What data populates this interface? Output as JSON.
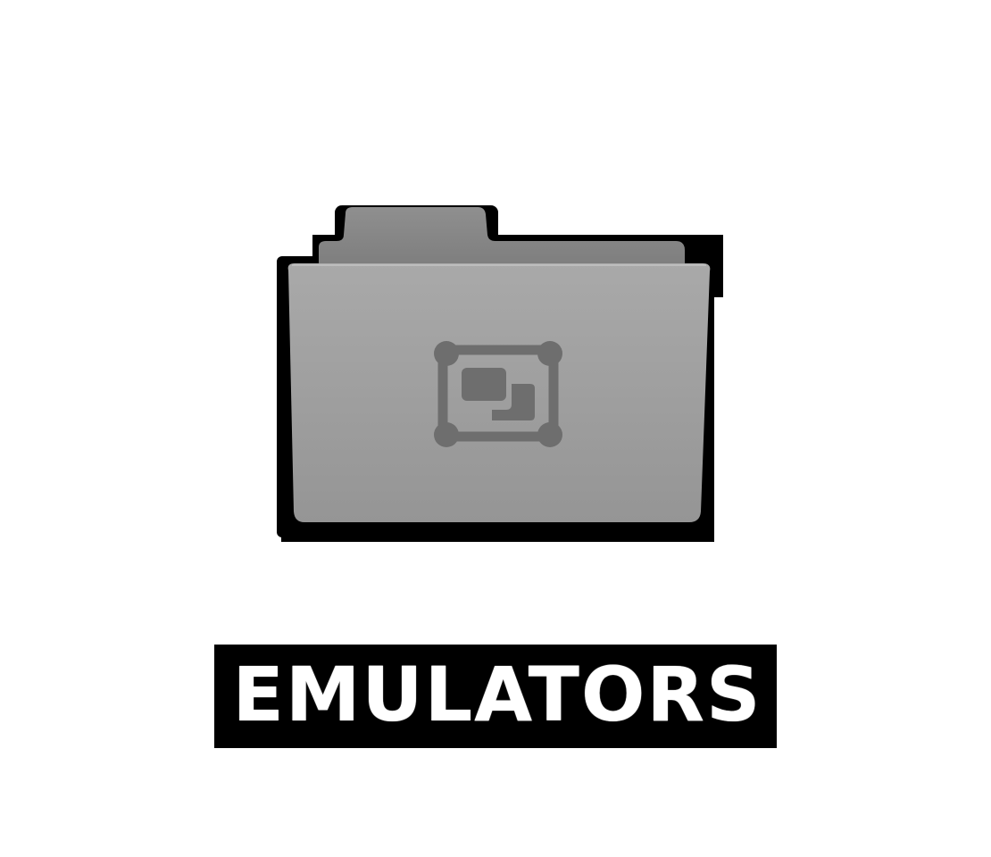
{
  "folder": {
    "label": "EMULATORS",
    "icon": "emulator-folder-icon",
    "emblem_icon": "emulator-window-icon"
  },
  "colors": {
    "background": "#ffffff",
    "folder_face": "#9c9c9c",
    "folder_tab": "#8a8a8a",
    "emblem": "#6e6e6e",
    "label_text": "#ffffff",
    "label_outline": "#000000"
  }
}
